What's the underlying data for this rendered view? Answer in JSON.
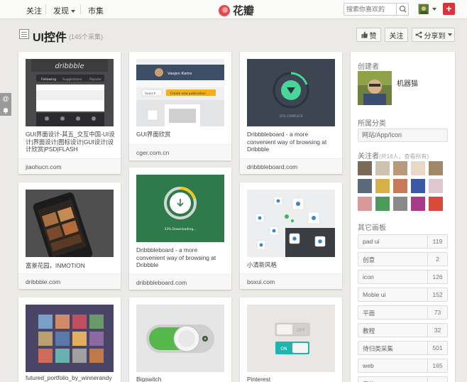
{
  "nav": {
    "follow": "关注",
    "discover": "发现",
    "market": "市集"
  },
  "logo": {
    "text": "花瓣",
    "brand_color": "#e5484d"
  },
  "search": {
    "placeholder": "搜索你喜欢的",
    "icon": "search-icon"
  },
  "add_button": {
    "label": "+"
  },
  "board": {
    "title": "UI控件",
    "count": "(145个采集)"
  },
  "header_buttons": {
    "like": "赞",
    "follow": "关注",
    "share": "分享到"
  },
  "pins": [
    {
      "caption": "GUI界面设计-其五_交互中国-UI设计|界面设计|图标设计|GUI设计|设计欣赏|PSD|FLASH",
      "source": "jiaohucn.com",
      "image_text": "dribbble",
      "tabs": [
        "Following",
        "Suggestions",
        "Popular"
      ]
    },
    {
      "caption": "GUI界面欣赏",
      "source": "cger.com.cn",
      "image_text": "Vasjen Katro",
      "search_label": "Search",
      "create_label": "Create new publication"
    },
    {
      "caption": "Dribbbleboard - a more convenient way of browsing at Dribbble",
      "source": "dribbbleboard.com",
      "image_text": "35% COMPLETE"
    },
    {
      "caption": "富景花园，INMOTION",
      "source": "dribbble.com",
      "image_text": ""
    },
    {
      "caption": "Dribbbleboard - a more convenient way of browsing at Dribbble",
      "source": "dribbbleboard.com",
      "image_text": "33% Downloading..."
    },
    {
      "caption": "小清新风格",
      "source": "boxui.com",
      "image_text": ""
    },
    {
      "caption": "futured_portfolio_by_winnerandy",
      "source": "",
      "image_text": ""
    },
    {
      "caption": "Bigswitch",
      "source": "",
      "image_text": ""
    },
    {
      "caption": "Pinterest",
      "source": "",
      "image_text": "",
      "off_label": "OFF",
      "on_label": "ON"
    }
  ],
  "sidebar": {
    "creator_heading": "创建者",
    "creator_name": "机器猫",
    "category_heading": "所属分类",
    "category": "网站/App/Icon",
    "followers_heading": "关注者",
    "followers_sub": "(共18人，查看所有)",
    "boards_heading": "其它画板",
    "boards": [
      {
        "name": "pad ui",
        "count": "119"
      },
      {
        "name": "创意",
        "count": "2"
      },
      {
        "name": "icon",
        "count": "126"
      },
      {
        "name": "Mobie ui",
        "count": "152"
      },
      {
        "name": "平面",
        "count": "73"
      },
      {
        "name": "教程",
        "count": "32"
      },
      {
        "name": "待归类采集",
        "count": "501"
      },
      {
        "name": "web",
        "count": "165"
      },
      {
        "name": "字体",
        "count": ""
      }
    ]
  }
}
